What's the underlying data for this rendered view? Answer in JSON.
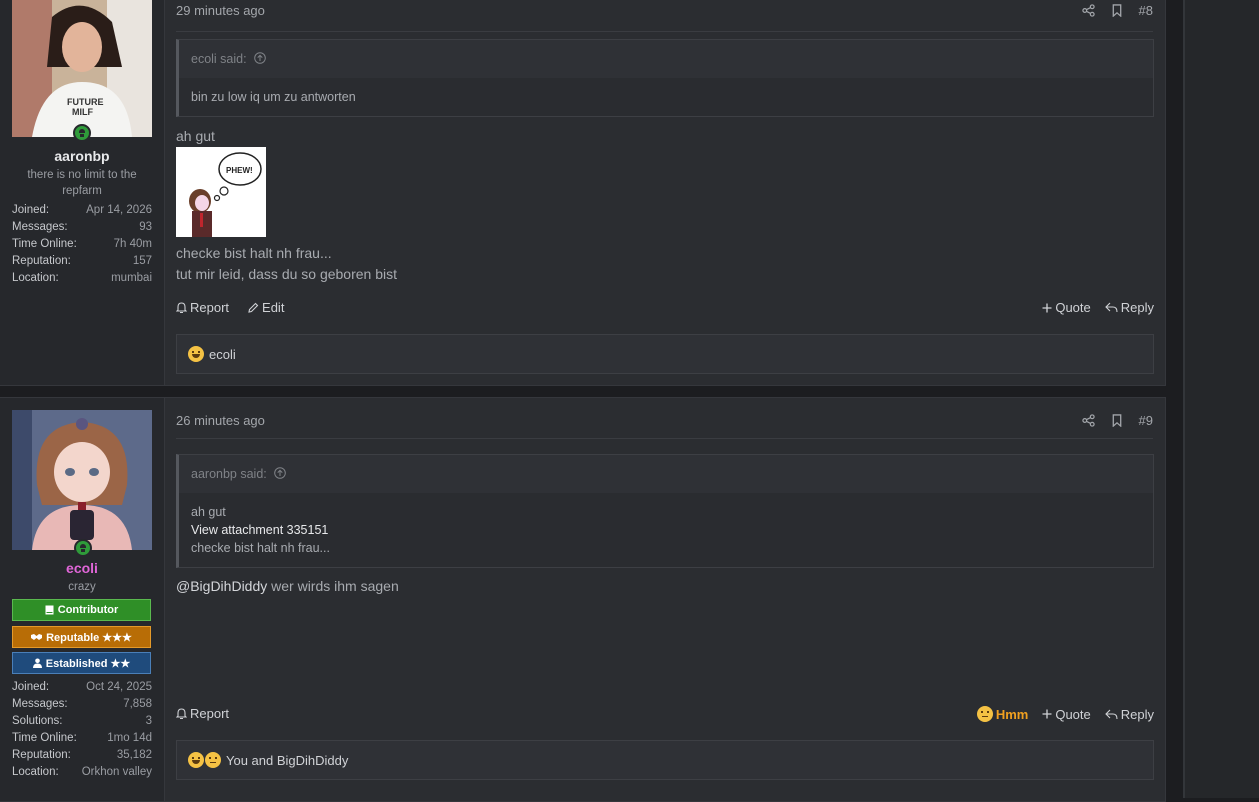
{
  "post8": {
    "time": "29 minutes ago",
    "number": "#8",
    "user": {
      "name": "aaronbp",
      "title": "there is no limit to the repfarm",
      "stats": [
        {
          "k": "Joined:",
          "v": "Apr 14, 2026"
        },
        {
          "k": "Messages:",
          "v": "93"
        },
        {
          "k": "Time Online:",
          "v": "7h 40m"
        },
        {
          "k": "Reputation:",
          "v": "157"
        },
        {
          "k": "Location:",
          "v": "mumbai"
        }
      ]
    },
    "quote": {
      "author": "ecoli said:",
      "text": "bin zu low iq um zu antworten"
    },
    "lines": [
      "ah gut",
      "checke bist halt nh frau...",
      "tut mir leid, dass du so geboren bist"
    ],
    "image_text": "PHEW!",
    "actions": {
      "report": "Report",
      "edit": "Edit",
      "quote": "Quote",
      "reply": "Reply"
    },
    "reactions": "ecoli"
  },
  "post9": {
    "time": "26 minutes ago",
    "number": "#9",
    "user": {
      "name": "ecoli",
      "name_color": "#e066d8",
      "title": "crazy",
      "badges": [
        "Contributor",
        "Reputable ★★★",
        "Established ★★"
      ],
      "stats": [
        {
          "k": "Joined:",
          "v": "Oct 24, 2025"
        },
        {
          "k": "Messages:",
          "v": "7,858"
        },
        {
          "k": "Solutions:",
          "v": "3"
        },
        {
          "k": "Time Online:",
          "v": "1mo 14d"
        },
        {
          "k": "Reputation:",
          "v": "35,182"
        },
        {
          "k": "Location:",
          "v": "Orkhon valley"
        }
      ]
    },
    "quote": {
      "author": "aaronbp said:",
      "line1": "ah gut",
      "line2": "View attachment 335151",
      "line3": "checke bist halt nh frau..."
    },
    "mention": "@BigDihDiddy",
    "message": " wer wirds ihm sagen",
    "actions": {
      "report": "Report",
      "hmm": "Hmm",
      "quote": "Quote",
      "reply": "Reply"
    },
    "reactions": "You and BigDihDiddy"
  },
  "icons": [
    "share-icon",
    "bookmark-icon",
    "bell-icon",
    "pencil-icon",
    "plus-icon",
    "reply-icon",
    "arrow-up-circle-icon",
    "laughing-emoji-icon",
    "thinking-emoji-icon",
    "book-icon",
    "handshake-icon",
    "user-icon"
  ]
}
